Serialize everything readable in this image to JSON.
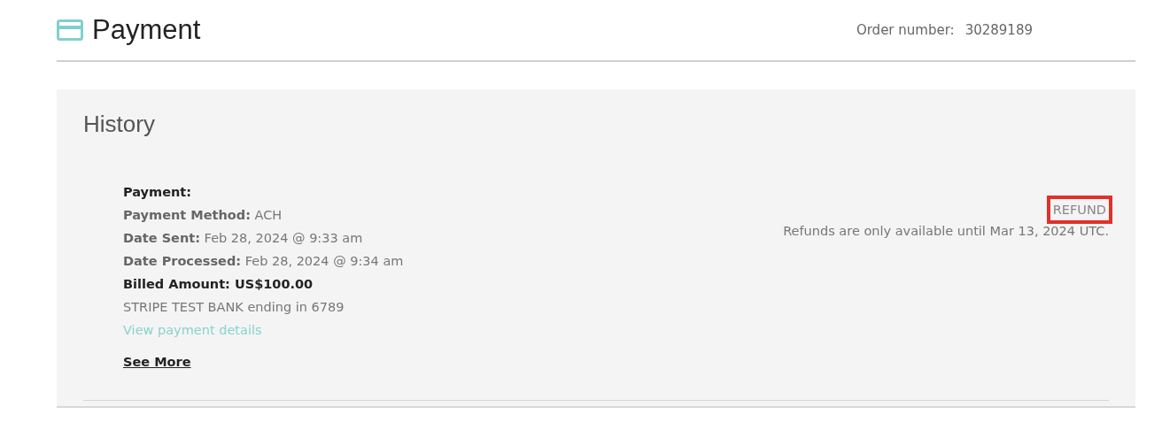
{
  "header": {
    "title": "Payment",
    "order_label": "Order number:",
    "order_number": "30289189"
  },
  "history": {
    "title": "History",
    "entry": {
      "heading": "Payment:",
      "lines": [
        {
          "kind": "plain",
          "text": "**Payment Method:** ACH"
        },
        {
          "kind": "plain",
          "text": "**Date Sent:** Feb 28, 2024 @ 9:33 am"
        },
        {
          "kind": "plain",
          "text": "**Date Processed:** Feb 28, 2024 @ 9:34 am"
        },
        {
          "kind": "strong",
          "text": "Billed Amount: US$100.00"
        },
        {
          "kind": "plain",
          "text": "STRIPE TEST BANK ending in 6789"
        },
        {
          "kind": "link",
          "text": "View payment details"
        }
      ],
      "see_more": "See More",
      "refund": {
        "label": "REFUND",
        "highlighted": true
      },
      "refund_note": "Refunds are only available until Mar 13, 2024 UTC."
    }
  }
}
